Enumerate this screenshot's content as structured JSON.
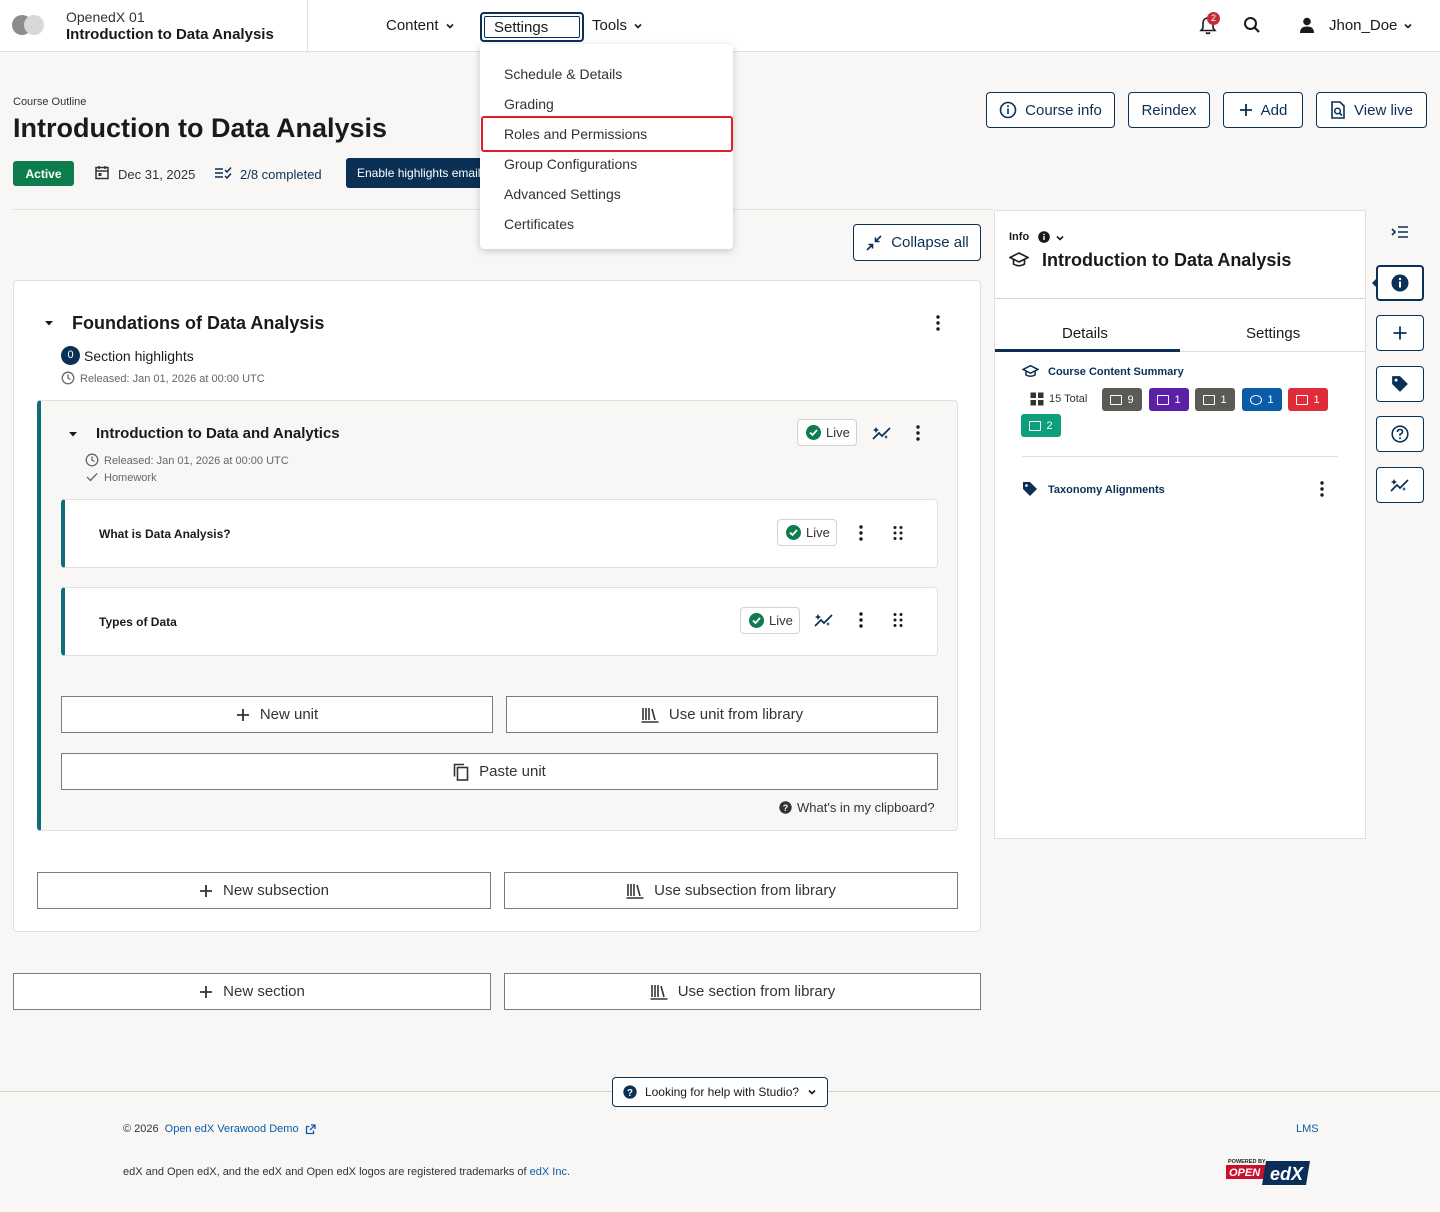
{
  "header": {
    "org": "OpenedX 01",
    "course_name": "Introduction to Data Analysis",
    "nav": {
      "content": "Content",
      "settings": "Settings",
      "tools": "Tools"
    },
    "notification_count": "2",
    "username": "Jhon_Doe"
  },
  "settings_menu": {
    "items": [
      "Schedule & Details",
      "Grading",
      "Roles and Permissions",
      "Group Configurations",
      "Advanced Settings",
      "Certificates"
    ],
    "highlighted": "Roles and Permissions"
  },
  "page": {
    "breadcrumb": "Course Outline",
    "title": "Introduction to Data Analysis",
    "actions": {
      "course_info": "Course info",
      "reindex": "Reindex",
      "add": "Add",
      "view_live": "View live"
    },
    "status": "Active",
    "date": "Dec 31, 2025",
    "completed": "2/8 completed",
    "enable_emails": "Enable highlights emails",
    "collapse_all": "Collapse all"
  },
  "section": {
    "title": "Foundations of Data Analysis",
    "highlights_count": "0",
    "highlights_label": "Section highlights",
    "released": "Released: Jan 01, 2026 at 00:00 UTC",
    "subsection": {
      "title": "Introduction to Data and Analytics",
      "status": "Live",
      "released": "Released: Jan 01, 2026 at 00:00 UTC",
      "grading": "Homework",
      "units": [
        {
          "title": "What is Data Analysis?",
          "status": "Live"
        },
        {
          "title": "Types of Data",
          "status": "Live"
        }
      ],
      "new_unit": "New unit",
      "use_unit_library": "Use unit from library",
      "paste_unit": "Paste unit",
      "clipboard_help": "What's in my clipboard?"
    },
    "new_subsection": "New subsection",
    "use_subsection_library": "Use subsection from library"
  },
  "outline_actions": {
    "new_section": "New section",
    "use_section_library": "Use section from library"
  },
  "sidebar": {
    "info_label": "Info",
    "title": "Introduction to Data Analysis",
    "tabs": [
      "Details",
      "Settings"
    ],
    "content_summary_title": "Course Content Summary",
    "total": "15 Total",
    "chips": [
      {
        "count": "9",
        "color": "#5c5a57"
      },
      {
        "count": "1",
        "color": "#5c1fa8"
      },
      {
        "count": "1",
        "color": "#5c5a57"
      },
      {
        "count": "1",
        "color": "#0a5ca8"
      },
      {
        "count": "1",
        "color": "#e02c3a"
      },
      {
        "count": "2",
        "color": "#0d9e7d"
      }
    ],
    "taxonomy": "Taxonomy Alignments"
  },
  "footer": {
    "help": "Looking for help with Studio?",
    "copyright": "© 2026",
    "demo_link": "Open edX Verawood Demo",
    "lms": "LMS",
    "trademark_pre": "edX and Open edX, and the edX and Open edX logos are registered trademarks of",
    "trademark_link": "edX Inc.",
    "powered_by": "POWERED BY",
    "logo_open": "OPEN",
    "logo_edx": "edX"
  }
}
